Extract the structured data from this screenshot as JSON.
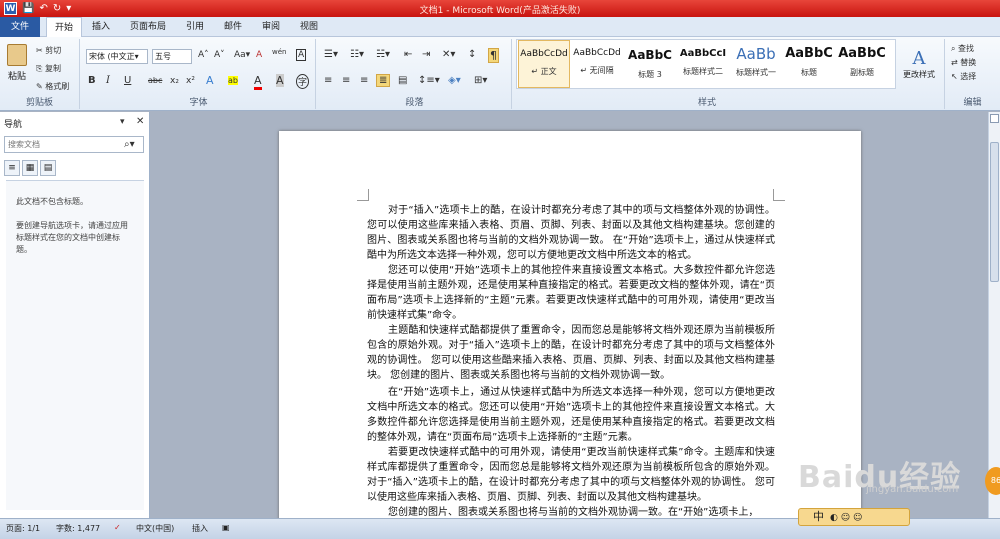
{
  "window": {
    "title": "文档1 - Microsoft Word(产品激活失败)"
  },
  "qat": {
    "app_icon": "W",
    "save_icon": "💾",
    "undo_icon": "↶",
    "redo_icon": "↻",
    "more_icon": "▾"
  },
  "tabs": [
    "文件",
    "开始",
    "插入",
    "页面布局",
    "引用",
    "邮件",
    "审阅",
    "视图"
  ],
  "ribbon": {
    "clipboard": {
      "label": "剪贴板",
      "paste": "粘贴",
      "cut": "剪切",
      "copy": "复制",
      "painter": "格式刷"
    },
    "font": {
      "label": "字体",
      "font_name": "宋体 (中文正▾",
      "font_size": "五号",
      "grow": "A˄",
      "shrink": "A˅",
      "case": "Aa▾",
      "clear": "A",
      "pinyin": "wén",
      "border_char": "A",
      "bold": "B",
      "italic": "I",
      "underline": "U",
      "strike": "abc",
      "sub": "x₂",
      "sup": "x²",
      "effect": "A",
      "highlight": "ab",
      "color": "A",
      "shade": "A",
      "circle": "字"
    },
    "paragraph": {
      "label": "段落"
    },
    "styles": {
      "label": "样式",
      "items": [
        {
          "preview": "AaBbCcDd",
          "name": "↵ 正文"
        },
        {
          "preview": "AaBbCcDd",
          "name": "↵ 无间隔"
        },
        {
          "preview": "AaBbC",
          "name": "标题 3"
        },
        {
          "preview": "AaBbCcI",
          "name": "标题样式二"
        },
        {
          "preview": "AaBb",
          "name": "标题样式一"
        },
        {
          "preview": "AaBbC",
          "name": "标题"
        },
        {
          "preview": "AaBbC",
          "name": "副标题"
        }
      ],
      "change": "更改样式"
    },
    "editing": {
      "label": "编辑",
      "find": "查找",
      "replace": "替换",
      "select": "选择"
    }
  },
  "nav": {
    "title": "导航",
    "search_placeholder": "搜索文档",
    "msg1": "此文档不包含标题。",
    "msg2": "要创建导航选项卡，请通过应用标题样式在您的文档中创建标题。"
  },
  "document": {
    "paragraphs": [
      "对于“插入”选项卡上的酷，在设计时都充分考虑了其中的项与文档整体外观的协调性。您可以使用这些库来插入表格、页眉、页脚、列表、封面以及其他文档构建基块。您创建的图片、图表或关系图也将与当前的文档外观协调一致。 在“开始”选项卡上，通过从快速样式酷中为所选文本选择一种外观，您可以方便地更改文档中所选文本的格式。",
      "您还可以使用“开始”选项卡上的其他控件来直接设置文本格式。大多数控件都允许您选择是使用当前主题外观，还是使用某种直接指定的格式。若要更改文档的整体外观，请在“页面布局”选项卡上选择新的“主题”元素。若要更改快速样式酷中的可用外观，请使用“更改当前快速样式集”命令。",
      "主题酷和快速样式酷都提供了重置命令，因而您总是能够将文档外观还原为当前模板所包含的原始外观。对于“插入”选项卡上的酷，在设计时都充分考虑了其中的项与文档整体外观的协调性。 您可以使用这些酷来插入表格、页眉、页脚、列表、封面以及其他文档构建基块。 您创建的图片、图表或关系图也将与当前的文档外观协调一致。",
      "在“开始”选项卡上，通过从快速样式酷中为所选文本选择一种外观，您可以方便地更改文档中所选文本的格式。您还可以使用“开始”选项卡上的其他控件来直接设置文本格式。大多数控件都允许您选择是使用当前主题外观，还是使用某种直接指定的格式。若要更改文档的整体外观，请在“页面布局”选项卡上选择新的“主题”元素。",
      "若要更改快速样式酷中的可用外观，请使用“更改当前快速样式集”命令。主题库和快速样式库都提供了重置命令，因而您总是能够将文档外观还原为当前模板所包含的原始外观。对于“插入”选项卡上的酷，在设计时都充分考虑了其中的项与文档整体外观的协调性。 您可以使用这些库来插入表格、页眉、页脚、列表、封面以及其他文档构建基块。",
      "您创建的图片、图表或关系图也将与当前的文档外观协调一致。在“开始”选项卡上，"
    ]
  },
  "status": {
    "page": "页面: 1/1",
    "words": "字数: 1,477",
    "lang": "中文(中国)",
    "mode": "插入"
  },
  "ime": {
    "label": "中"
  },
  "watermark": {
    "logo": "Baidu经验",
    "url": "jingyan.baidu.com",
    "badge": "86"
  }
}
